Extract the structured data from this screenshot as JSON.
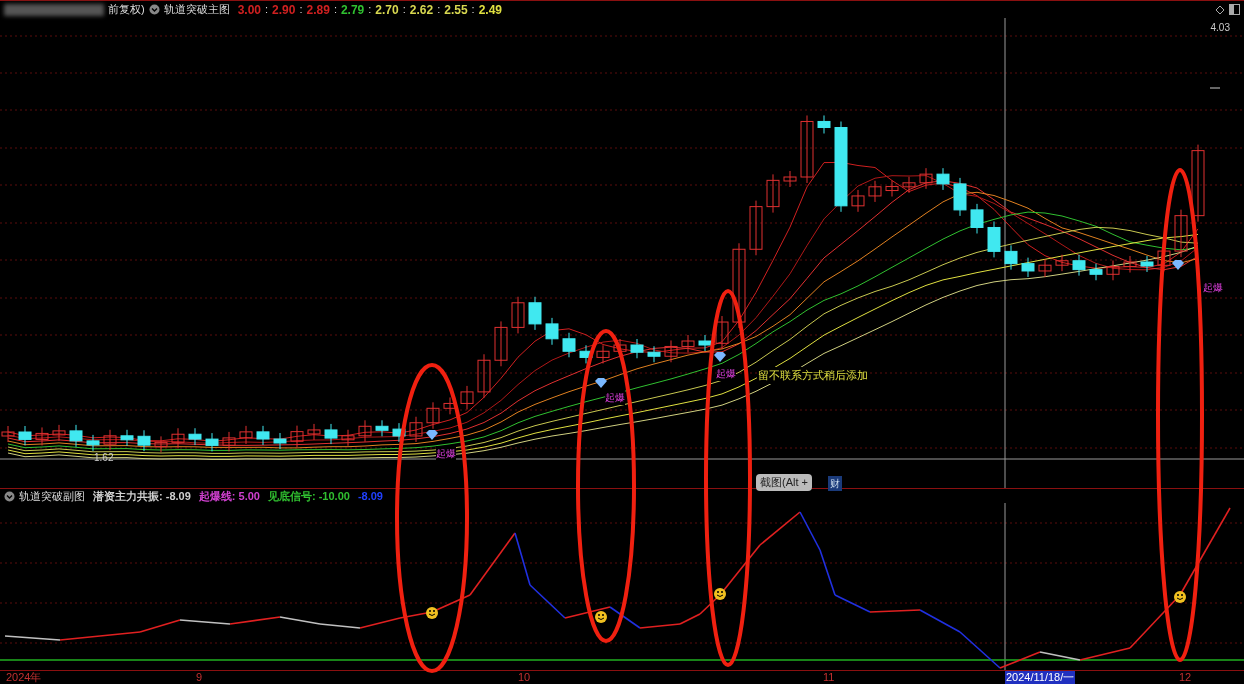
{
  "main_chart": {
    "adjust": "前复权)",
    "title": "轨道突破主图",
    "values": [
      {
        "text": "3.00",
        "color": "#d02020"
      },
      {
        "sep": ":",
        "text": "2.90",
        "color": "#d02020"
      },
      {
        "sep": ":",
        "text": "2.89",
        "color": "#d02020"
      },
      {
        "sep": ":",
        "text": "2.79",
        "color": "#30c030"
      },
      {
        "sep": ":",
        "text": "2.70",
        "color": "#d8d850"
      },
      {
        "sep": ":",
        "text": "2.62",
        "color": "#d8d850"
      },
      {
        "sep": ":",
        "text": "2.55",
        "color": "#d8d850"
      },
      {
        "sep": ":",
        "text": "2.49",
        "color": "#e0e040"
      }
    ],
    "price_high": "4.03",
    "price_low": "1.62",
    "signals": [
      {
        "text": "起爆"
      },
      {
        "text": "起爆"
      },
      {
        "text": "起爆"
      },
      {
        "text": "起爆"
      }
    ],
    "note": "留不联系方式稍后添加"
  },
  "tooltip": "截图(Alt +",
  "badge": "财",
  "sub_chart": {
    "title": "轨道突破副图",
    "indicators": [
      {
        "label": "潜资主力共振:",
        "value": "-8.09",
        "color": "#d0d0d0"
      },
      {
        "label": "起爆线:",
        "value": "5.00",
        "color": "#d040d0"
      },
      {
        "label": "见底信号:",
        "value": "-10.00",
        "color": "#30c030"
      },
      {
        "value": "-8.09",
        "color": "#2040ff"
      }
    ]
  },
  "x_axis": [
    {
      "label": "2024年",
      "selected": false
    },
    {
      "label": "9",
      "selected": false
    },
    {
      "label": "10",
      "selected": false
    },
    {
      "label": "11",
      "selected": false
    },
    {
      "label": "2024/11/18/一",
      "selected": true
    },
    {
      "label": "12",
      "selected": false
    }
  ]
}
